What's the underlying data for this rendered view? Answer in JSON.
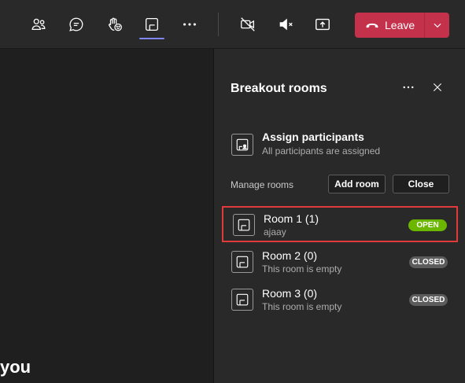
{
  "toolbar": {
    "icons": [
      "people-icon",
      "chat-icon",
      "react-icon",
      "breakout-rooms-icon",
      "more-icon",
      "camera-off-icon",
      "mic-muted-icon",
      "share-icon"
    ],
    "leave_label": "Leave"
  },
  "stage": {
    "partial_text": "you"
  },
  "panel": {
    "title": "Breakout rooms",
    "assign": {
      "title": "Assign participants",
      "subtitle": "All participants are assigned"
    },
    "manage_label": "Manage rooms",
    "add_room_label": "Add room",
    "close_label": "Close",
    "rooms": [
      {
        "name": "Room 1 (1)",
        "sub": "ajaay",
        "status": "OPEN"
      },
      {
        "name": "Room 2 (0)",
        "sub": "This room is empty",
        "status": "CLOSED"
      },
      {
        "name": "Room 3 (0)",
        "sub": "This room is empty",
        "status": "CLOSED"
      }
    ]
  },
  "colors": {
    "accent": "#7f85f5",
    "leave": "#c4314b",
    "open": "#6bb700",
    "closed": "#5c5c5c",
    "highlight": "#e03a3a"
  }
}
